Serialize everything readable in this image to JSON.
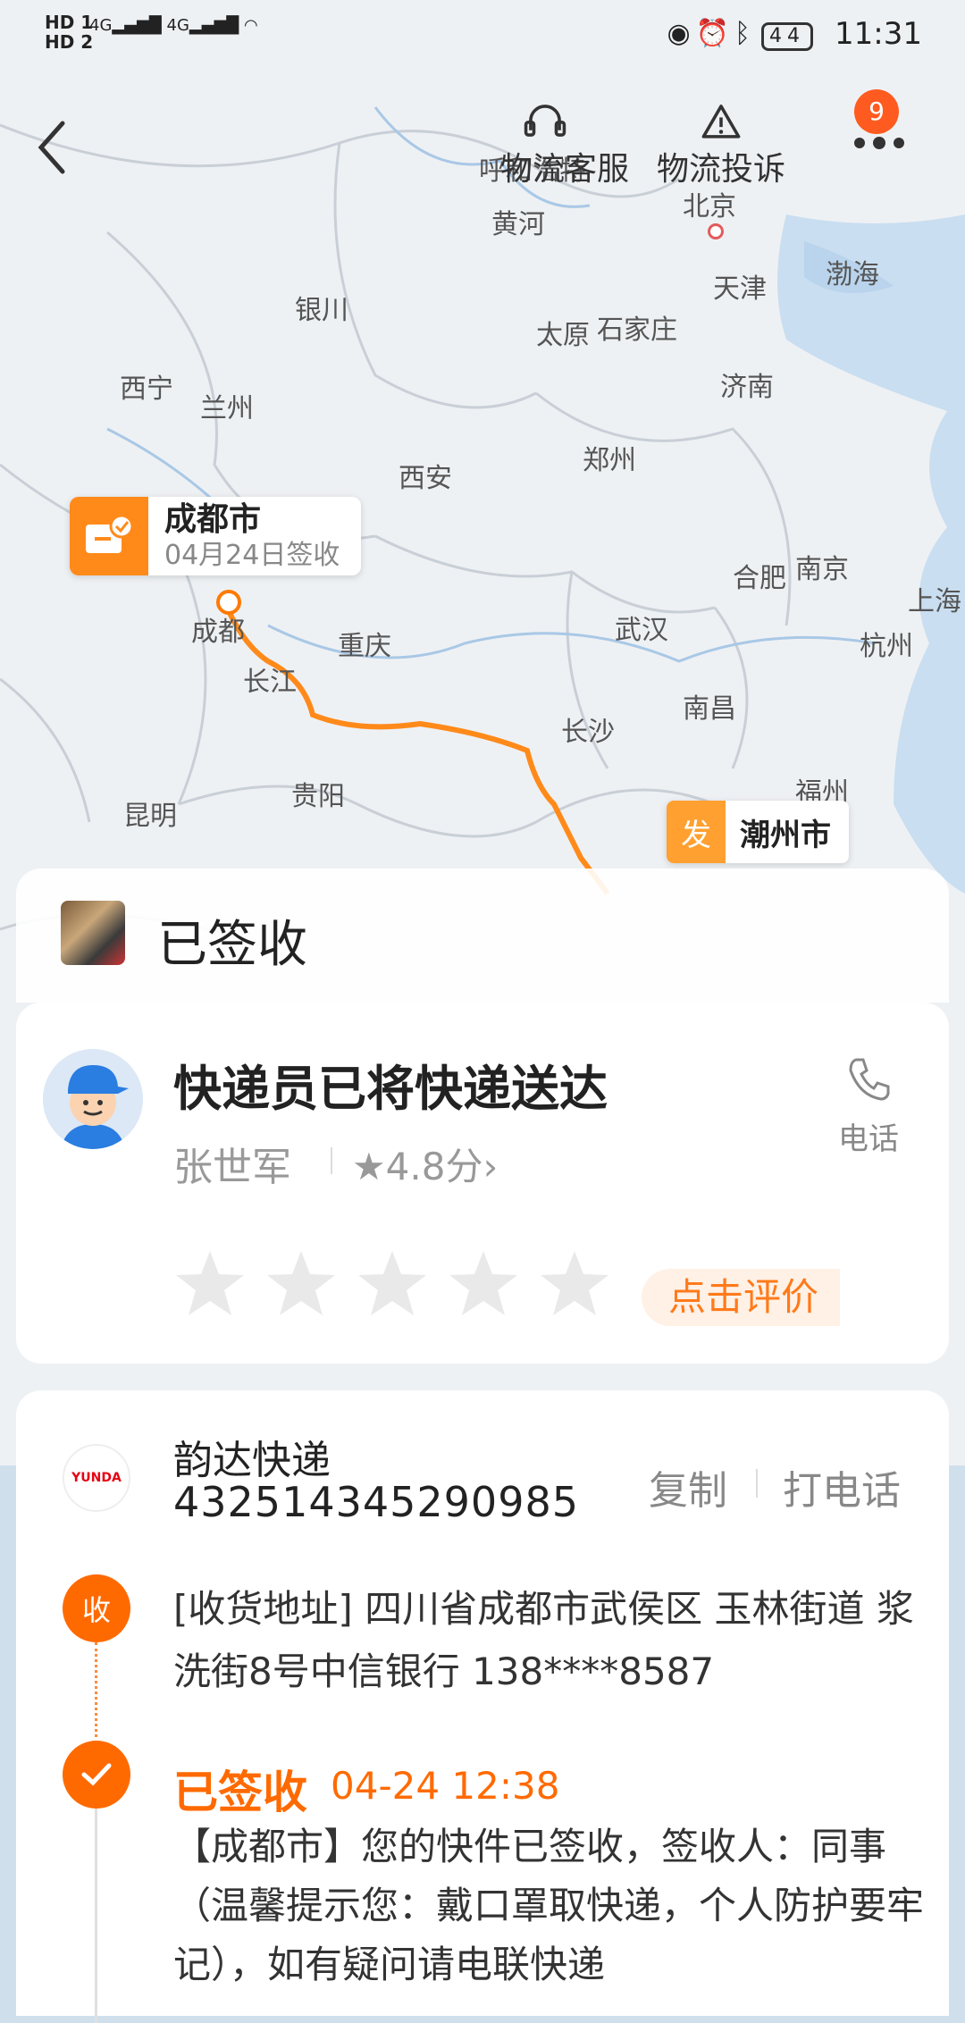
{
  "status_bar": {
    "sim1": "HD 1",
    "sim2": "HD 2",
    "net1": "4G",
    "net2": "4G",
    "battery": "44",
    "time": "11:31"
  },
  "top_bar": {
    "service_label": "物流客服",
    "complaint_label": "物流投诉",
    "notification_count": "9"
  },
  "map": {
    "cities": [
      "呼和浩特",
      "黄河",
      "北京",
      "渤海",
      "天津",
      "银川",
      "太原",
      "石家庄",
      "西宁",
      "兰州",
      "济南",
      "郑州",
      "西安",
      "合肥",
      "南京",
      "上海",
      "成都",
      "重庆",
      "武汉",
      "杭州",
      "长江",
      "南昌",
      "长沙",
      "贵阳",
      "福州",
      "昆明"
    ]
  },
  "destination": {
    "city": "成都市",
    "date": "04月24日签收"
  },
  "origin": {
    "tag": "发",
    "city": "潮州市"
  },
  "status": {
    "title": "已签收"
  },
  "courier": {
    "title": "快递员已将快递送达",
    "name": "张世军",
    "rating": "4.8分",
    "phone_label": "电话",
    "rate_label": "点击评价",
    "stars": 5
  },
  "shipment": {
    "carrier": "韵达快递",
    "logo_text": "YUNDA",
    "tracking_no": "432514345290985",
    "copy_label": "复制",
    "call_label": "打电话",
    "address_tag": "收",
    "address": "[收货地址] 四川省成都市武侯区 玉林街道   浆洗街8号中信银行 138****8587",
    "signed_title": "已签收",
    "signed_time": "04-24 12:38",
    "signed_desc": "【成都市】您的快件已签收，签收人：同事（温馨提示您：戴口罩取快递，个人防护要牢记），如有疑问请电联快递"
  },
  "colors": {
    "accent": "#ff6a00",
    "route": "#ff8a1a",
    "map_bg": "#e8eef2",
    "water": "#c6dcee"
  }
}
